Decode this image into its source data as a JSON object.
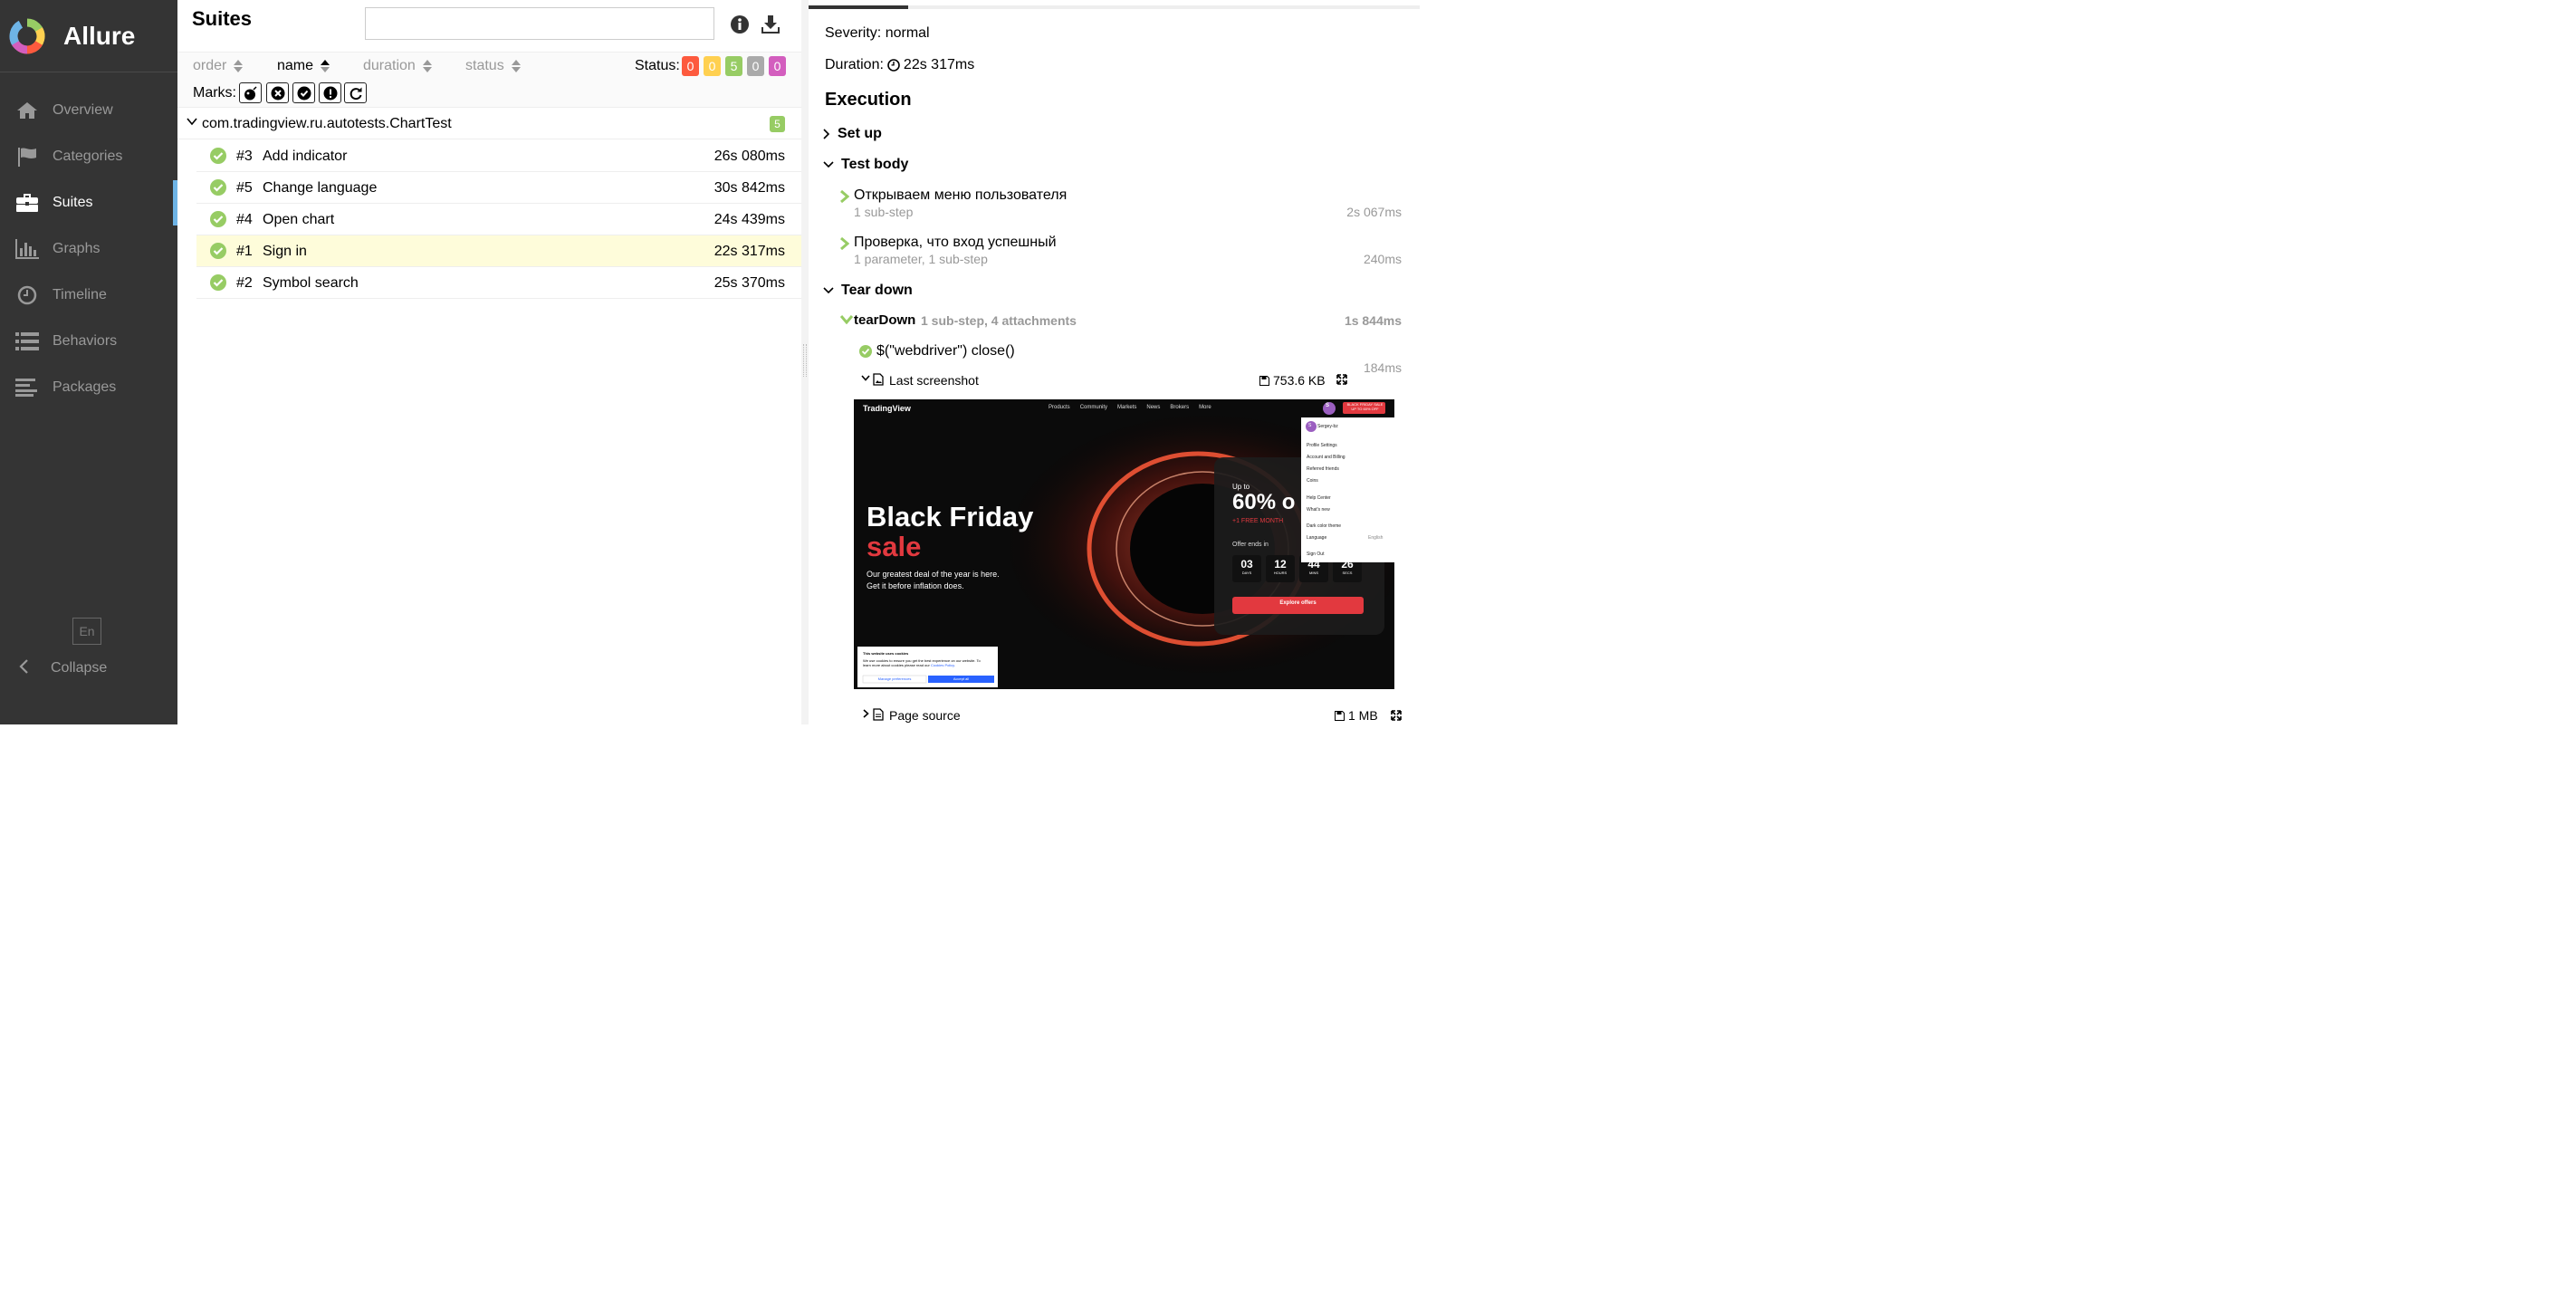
{
  "app": {
    "name": "Allure"
  },
  "sidebar": {
    "items": [
      {
        "label": "Overview",
        "icon": "home-icon"
      },
      {
        "label": "Categories",
        "icon": "flag-icon"
      },
      {
        "label": "Suites",
        "icon": "briefcase-icon",
        "active": true
      },
      {
        "label": "Graphs",
        "icon": "bar-chart-icon"
      },
      {
        "label": "Timeline",
        "icon": "clock-icon"
      },
      {
        "label": "Behaviors",
        "icon": "list-icon"
      },
      {
        "label": "Packages",
        "icon": "align-left-icon"
      }
    ],
    "language": "En",
    "collapse_label": "Collapse",
    "active_color": "#6eb4e6"
  },
  "suites": {
    "title": "Suites",
    "search": {
      "value": "",
      "placeholder": ""
    },
    "sort": {
      "order": "order",
      "name": "name",
      "duration": "duration",
      "status": "status"
    },
    "status_label": "Status:",
    "status_counts": [
      {
        "value": "0",
        "color": "#fd5a3e"
      },
      {
        "value": "0",
        "color": "#ffd050"
      },
      {
        "value": "5",
        "color": "#97cc64"
      },
      {
        "value": "0",
        "color": "#aaaaaa"
      },
      {
        "value": "0",
        "color": "#d35ebe"
      }
    ],
    "marks_label": "Marks:",
    "group": {
      "name": "com.tradingview.ru.autotests.ChartTest",
      "count": "5"
    },
    "rows": [
      {
        "num": "#3",
        "name": "Add indicator",
        "duration": "26s 080ms"
      },
      {
        "num": "#5",
        "name": "Change language",
        "duration": "30s 842ms"
      },
      {
        "num": "#4",
        "name": "Open chart",
        "duration": "24s 439ms"
      },
      {
        "num": "#1",
        "name": "Sign in",
        "duration": "22s 317ms",
        "selected": true
      },
      {
        "num": "#2",
        "name": "Symbol search",
        "duration": "25s 370ms"
      }
    ]
  },
  "detail": {
    "severity": "Severity: normal",
    "duration_label": "Duration:",
    "duration": "22s 317ms",
    "execution": "Execution",
    "setup": "Set up",
    "test_body": "Test body",
    "steps": [
      {
        "title": "Открываем меню пользователя",
        "sub": "1 sub-step",
        "duration": "2s 067ms"
      },
      {
        "title": "Проверка, что вход успешный",
        "sub": "1 parameter, 1 sub-step",
        "duration": "240ms"
      }
    ],
    "teardown": "Tear down",
    "teardown_step": {
      "title": "tearDown",
      "sub": "1 sub-step, 4 attachments",
      "duration": "1s 844ms"
    },
    "substep": {
      "title": "$(\"webdriver\") close()",
      "duration": "184ms"
    },
    "attachments": [
      {
        "name": "Last screenshot",
        "size": "753.6 KB",
        "expanded": true
      },
      {
        "name": "Page source",
        "size": "1 MB",
        "expanded": false
      }
    ]
  },
  "screenshot": {
    "brand": "TradingView",
    "nav": [
      "Products",
      "Community",
      "Markets",
      "News",
      "Brokers",
      "More"
    ],
    "promo": "BLACK FRIDAY SALE",
    "promo_sub": "UP TO 60% OFF",
    "avatar_letter": "S",
    "headline1": "Black Friday",
    "headline2": "sale",
    "tagline1": "Our greatest deal of the year is here.",
    "tagline2": "Get it before inflation does.",
    "offer_up_to": "Up to",
    "offer_pct": "60% o",
    "offer_free": "+1 FREE MONTH",
    "offer_ends": "Offer ends in",
    "countdown": [
      {
        "value": "03",
        "unit": "DAYS"
      },
      {
        "value": "12",
        "unit": "HOURS"
      },
      {
        "value": "44",
        "unit": "MINS"
      },
      {
        "value": "26",
        "unit": "SECS"
      }
    ],
    "explore": "Explore offers",
    "menu": {
      "user": "Sergey-bz",
      "items": [
        "Profile Settings",
        "Account and Billing",
        "Referred friends",
        "Coins",
        "Help Center",
        "What's new",
        "Dark color theme",
        "Language",
        "Sign Out"
      ],
      "language_value": "English"
    },
    "cookie": {
      "title": "This website uses cookies",
      "text1": "We use cookies to ensure you get the best experience on our website. To",
      "text2": "learn more about cookies please read our",
      "link": "Cookies Policy.",
      "manage": "Manage preferences",
      "accept": "Accept all"
    }
  }
}
